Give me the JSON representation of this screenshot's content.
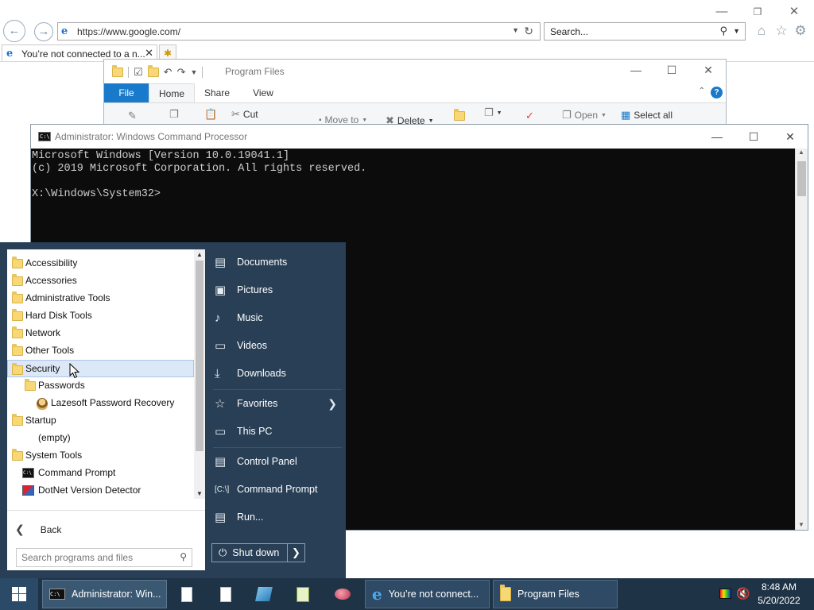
{
  "ie": {
    "address_url": "https://www.google.com/",
    "search_placeholder": "Search...",
    "tab_title": "You’re not connected to a n..."
  },
  "explorer": {
    "title": "Program Files",
    "ribbon_tabs": [
      "File",
      "Home",
      "Share",
      "View"
    ],
    "ribbon_buttons": {
      "cut": "Cut",
      "move_to": "Move to",
      "delete": "Delete",
      "open": "Open",
      "select_all": "Select all"
    }
  },
  "cmd": {
    "title": "Administrator: Windows Command Processor",
    "console_lines": [
      "Microsoft Windows [Version 10.0.19041.1]",
      "(c) 2019 Microsoft Corporation. All rights reserved.",
      "",
      "X:\\Windows\\System32>"
    ]
  },
  "start_menu": {
    "programs": [
      {
        "label": "Accessibility",
        "kind": "folder"
      },
      {
        "label": "Accessories",
        "kind": "folder"
      },
      {
        "label": "Administrative Tools",
        "kind": "folder"
      },
      {
        "label": "Hard Disk Tools",
        "kind": "folder"
      },
      {
        "label": "Network",
        "kind": "folder"
      },
      {
        "label": "Other Tools",
        "kind": "folder"
      },
      {
        "label": "Security",
        "kind": "folder",
        "selected": true
      },
      {
        "label": "Passwords",
        "kind": "folder"
      },
      {
        "label": "Lazesoft Password Recovery",
        "kind": "app"
      },
      {
        "label": "Startup",
        "kind": "folder"
      },
      {
        "label": "(empty)",
        "kind": "text"
      },
      {
        "label": "System Tools",
        "kind": "folder"
      },
      {
        "label": "Command Prompt",
        "kind": "app"
      },
      {
        "label": "DotNet Version Detector",
        "kind": "app"
      }
    ],
    "back_label": "Back",
    "search_placeholder": "Search programs and files",
    "right_items": [
      {
        "label": "Documents",
        "icon": "documents-icon"
      },
      {
        "label": "Pictures",
        "icon": "pictures-icon"
      },
      {
        "label": "Music",
        "icon": "music-icon"
      },
      {
        "label": "Videos",
        "icon": "videos-icon"
      },
      {
        "label": "Downloads",
        "icon": "downloads-icon"
      },
      {
        "label": "Favorites",
        "icon": "star-icon"
      },
      {
        "label": "This PC",
        "icon": "computer-icon"
      },
      {
        "label": "Control Panel",
        "icon": "control-panel-icon"
      },
      {
        "label": "Command Prompt",
        "icon": "command-prompt-icon"
      },
      {
        "label": "Run...",
        "icon": "run-icon"
      }
    ],
    "shutdown_label": "Shut down"
  },
  "taskbar": {
    "tasks": [
      {
        "label": "Administrator: Win...",
        "state": "active"
      },
      {
        "label": "You’re not connect...",
        "state": "open"
      },
      {
        "label": "Program Files",
        "state": "open"
      }
    ],
    "clock_time": "8:48 AM",
    "clock_date": "5/20/2022"
  },
  "colors": {
    "start_menu_bg": "#283f56",
    "taskbar_bg": "#1f3346",
    "selection": "#dde8f6",
    "ribbon_file": "#1979ca"
  }
}
